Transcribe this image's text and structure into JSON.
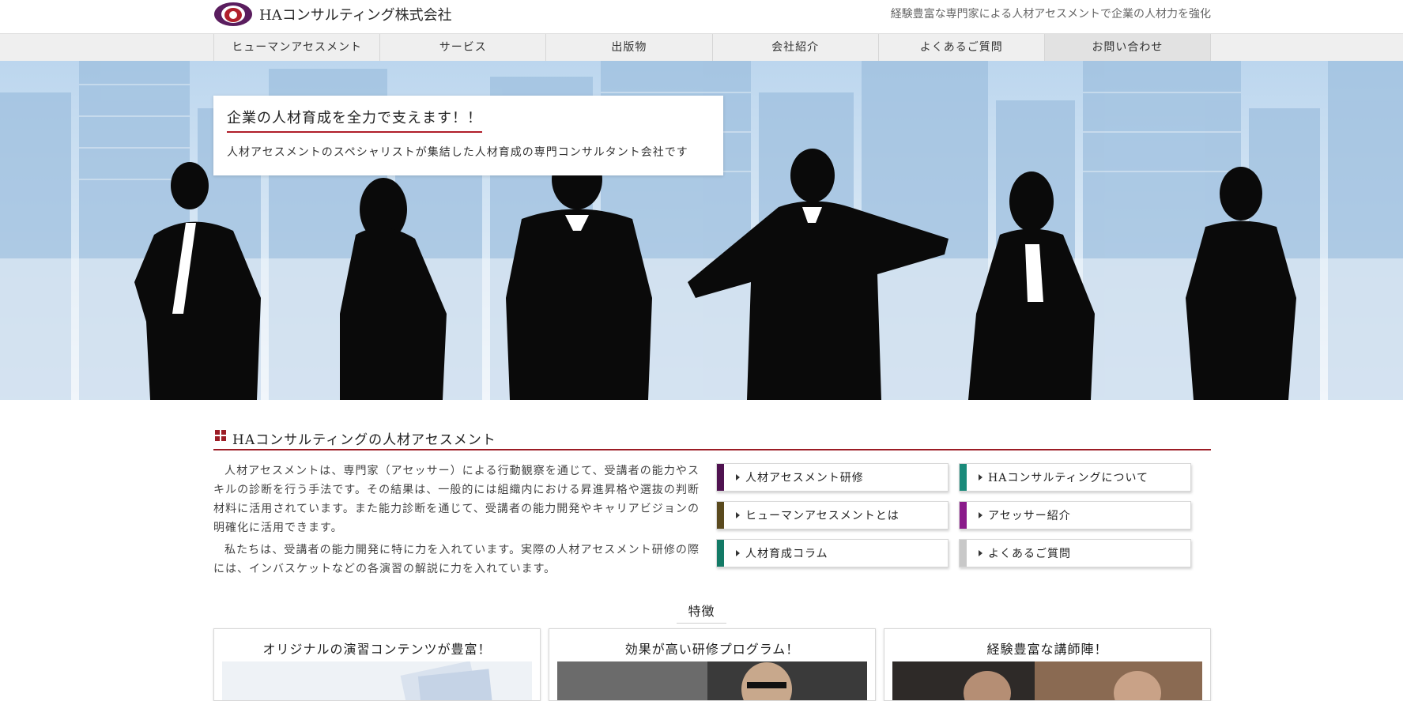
{
  "header": {
    "company_name": "HAコンサルティング株式会社",
    "tagline": "経験豊富な専門家による人材アセスメントで企業の人材力を強化"
  },
  "nav": [
    {
      "label": "ヒューマンアセスメント"
    },
    {
      "label": "サービス"
    },
    {
      "label": "出版物"
    },
    {
      "label": "会社紹介"
    },
    {
      "label": "よくあるご質問"
    },
    {
      "label": "お問い合わせ"
    }
  ],
  "hero": {
    "title": "企業の人材育成を全力で支えます！！",
    "subtitle": "人材アセスメントのスペシャリストが集結した人材育成の専門コンサルタント会社です"
  },
  "section": {
    "title": "HAコンサルティングの人材アセスメント",
    "paragraphs": [
      "人材アセスメントは、専門家（アセッサー）による行動観察を通じて、受講者の能力やスキルの診断を行う手法です。その結果は、一般的には組織内における昇進昇格や選抜の判断材料に活用されています。また能力診断を通じて、受講者の能力開発やキャリアビジョンの明確化に活用できます。",
      "私たちは、受講者の能力開発に特に力を入れています。実際の人材アセスメント研修の際には、インバスケットなどの各演習の解説に力を入れています。"
    ]
  },
  "links": [
    {
      "label": "人材アセスメント研修",
      "color": "#4f1250"
    },
    {
      "label": "HAコンサルティングについて",
      "color": "#1a8a7a"
    },
    {
      "label": "ヒューマンアセスメントとは",
      "color": "#5a4a1e"
    },
    {
      "label": "アセッサー紹介",
      "color": "#8a1a8a"
    },
    {
      "label": "人材育成コラム",
      "color": "#137a66"
    },
    {
      "label": "よくあるご質問",
      "color": "#c8c8c8"
    }
  ],
  "features": {
    "heading": "特徴",
    "cards": [
      {
        "title": "オリジナルの演習コンテンツが豊富！"
      },
      {
        "title": "効果が高い研修プログラム！"
      },
      {
        "title": "経験豊富な講師陣！"
      }
    ]
  }
}
